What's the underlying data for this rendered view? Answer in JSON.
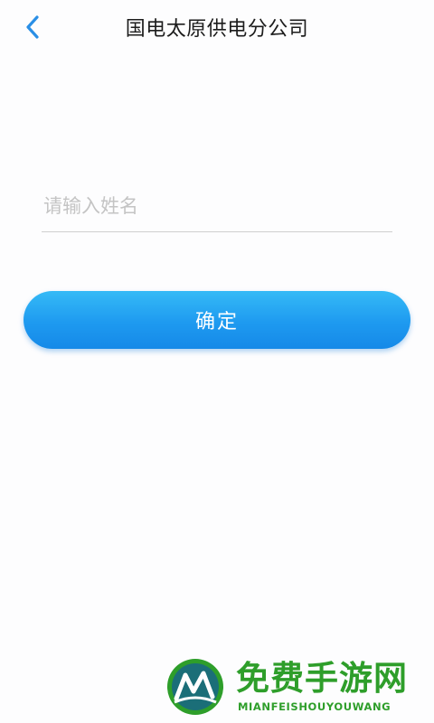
{
  "header": {
    "back_icon": "chevron-left-icon",
    "title": "国电太原供电分公司"
  },
  "form": {
    "name_placeholder": "请输入姓名",
    "name_value": "",
    "confirm_label": "确定"
  },
  "colors": {
    "accent": "#1e9af0",
    "back_icon": "#2a8fe6",
    "background": "#fdfdfe",
    "watermark_green": "#2e9e2a",
    "watermark_teal": "#1b6e78"
  },
  "watermark": {
    "logo_icon": "stylized-m-logo-icon",
    "title": "免费手游网",
    "subtitle": "MIANFEISHOUYOUWANG"
  }
}
